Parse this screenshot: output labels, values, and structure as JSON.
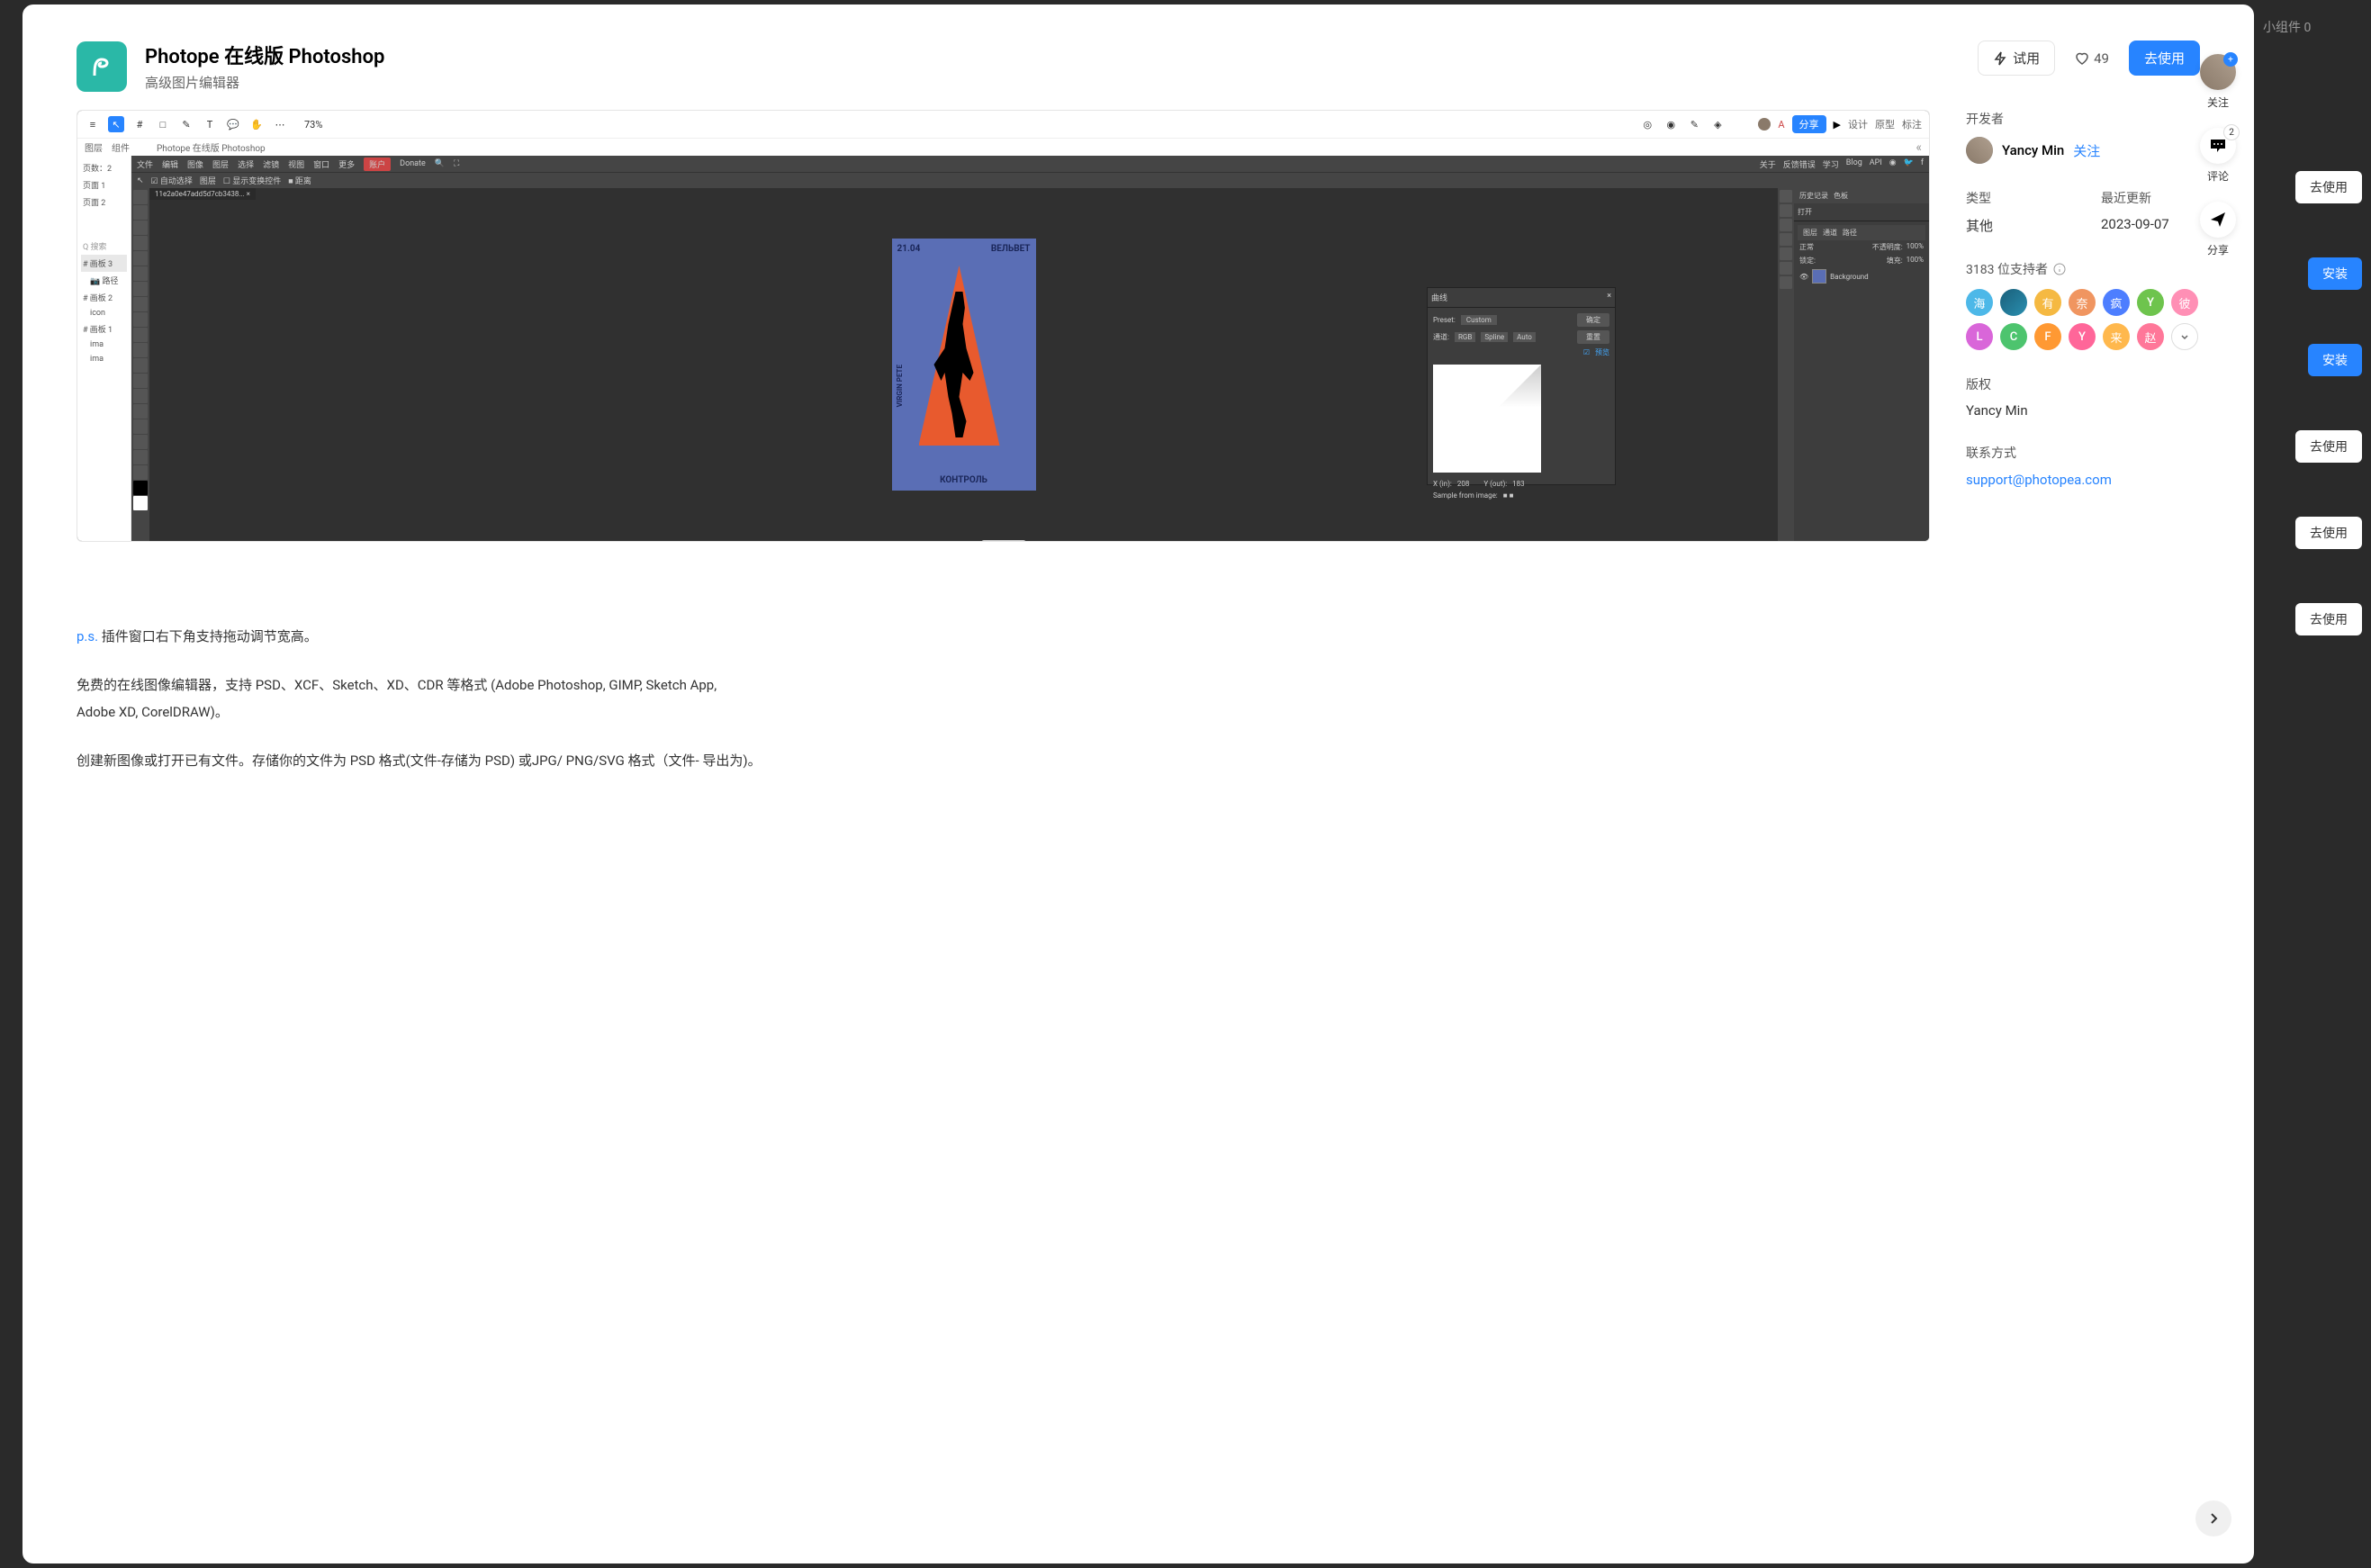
{
  "app": {
    "title": "Photope 在线版 Photoshop",
    "subtitle": "高级图片编辑器"
  },
  "actions": {
    "try": "试用",
    "likes": "49",
    "use": "去使用"
  },
  "screenshot": {
    "toolbar": {
      "zoom": "73% ",
      "share": "分享",
      "tabs": [
        "设计",
        "原型",
        "标注"
      ],
      "sub_l": "图层",
      "sub_l2": "组件",
      "title": "Photope 在线版 Photoshop"
    },
    "left_panel": {
      "pages": "页数：2",
      "items": [
        "页面 1",
        "页面 2"
      ],
      "search": "搜索",
      "layers": [
        "# 画板 3",
        "路径",
        "# 画板 2",
        "icon",
        "# 画板 1",
        "ima",
        "ima"
      ]
    },
    "menubar": [
      "文件",
      "编辑",
      "图像",
      "图层",
      "选择",
      "滤镜",
      "视图",
      "窗口",
      "更多",
      "账户",
      "Donate"
    ],
    "menubar_right": [
      "关于",
      "反馈错误",
      "学习",
      "Blog",
      "API"
    ],
    "optbar": [
      "自动选择",
      "图层",
      "显示变换控件",
      "距离"
    ],
    "canvas": {
      "tab": "11e2a0e47add5d7cb3438...",
      "date": "21.04",
      "text_right": "ВЕЛЬВЕТ",
      "text_left": "VIRGIN PETE",
      "text_bottom": "КОНТРОЛЬ"
    },
    "curves": {
      "title": "曲线",
      "preset_label": "Preset:",
      "preset_value": "Custom",
      "channel_label": "通道:",
      "channel_value": "RGB",
      "spline": "Spline",
      "auto": "Auto",
      "ok": "确定",
      "reset": "重置",
      "preview": "预览",
      "x_label": "X (in):",
      "x_val": "208",
      "y_label": "Y (out):",
      "y_val": "183",
      "sample": "Sample from image:"
    },
    "right_panel": {
      "history": "历史记录",
      "color": "色板",
      "open": "打开",
      "layers_tab": "图层",
      "channels_tab": "通道",
      "paths_tab": "路径",
      "normal": "正常",
      "opacity_label": "不透明度:",
      "opacity": "100%",
      "lock": "锁定:",
      "fill_label": "填充:",
      "fill": "100%",
      "bg_layer": "Background"
    }
  },
  "description": {
    "ps_prefix": "p.s.",
    "ps_text": " 插件窗口右下角支持拖动调节宽高。",
    "p1": "免费的在线图像编辑器，支持 PSD、XCF、Sketch、XD、CDR 等格式 (Adobe Photoshop, GIMP, Sketch App,",
    "p1b": "Adobe XD, CorelDRAW)。",
    "p2": "创建新图像或打开已有文件。存储你的文件为 PSD 格式(文件-存储为 PSD)    或JPG/ PNG/SVG 格式（文件- 导出为)。"
  },
  "info": {
    "developer_label": "开发者",
    "developer_name": "Yancy Min",
    "follow": "关注",
    "type_label": "类型",
    "type_value": "其他",
    "updated_label": "最近更新",
    "updated_value": "2023-09-07",
    "supporters_count": "3183 位支持者",
    "supporters": [
      {
        "char": "海",
        "color": "#4db8e8"
      },
      {
        "char": "",
        "color": "#1a5f7a",
        "img": true
      },
      {
        "char": "有",
        "color": "#f5b942"
      },
      {
        "char": "奈",
        "color": "#f09560"
      },
      {
        "char": "疯",
        "color": "#4d7eff"
      },
      {
        "char": "Y",
        "color": "#6ec44d"
      },
      {
        "char": "彼",
        "color": "#ff8fb5"
      },
      {
        "char": "L",
        "color": "#d966d9"
      },
      {
        "char": "C",
        "color": "#4dc46e"
      },
      {
        "char": "F",
        "color": "#ff9933"
      },
      {
        "char": "Y",
        "color": "#ff6699"
      },
      {
        "char": "来",
        "color": "#ffb84d"
      },
      {
        "char": "赵",
        "color": "#ff7799"
      }
    ],
    "supporters_more": "∨",
    "copyright_label": "版权",
    "copyright_value": "Yancy Min",
    "contact_label": "联系方式",
    "contact_value": "support@photopea.com"
  },
  "float": {
    "follow": "关注",
    "comment": "评论",
    "comment_count": "2",
    "share": "分享"
  },
  "bg_right": {
    "title": "小组件 0",
    "buttons": [
      "去使用",
      "安装",
      "安装",
      "去使用",
      "去使用",
      "去使用"
    ]
  }
}
